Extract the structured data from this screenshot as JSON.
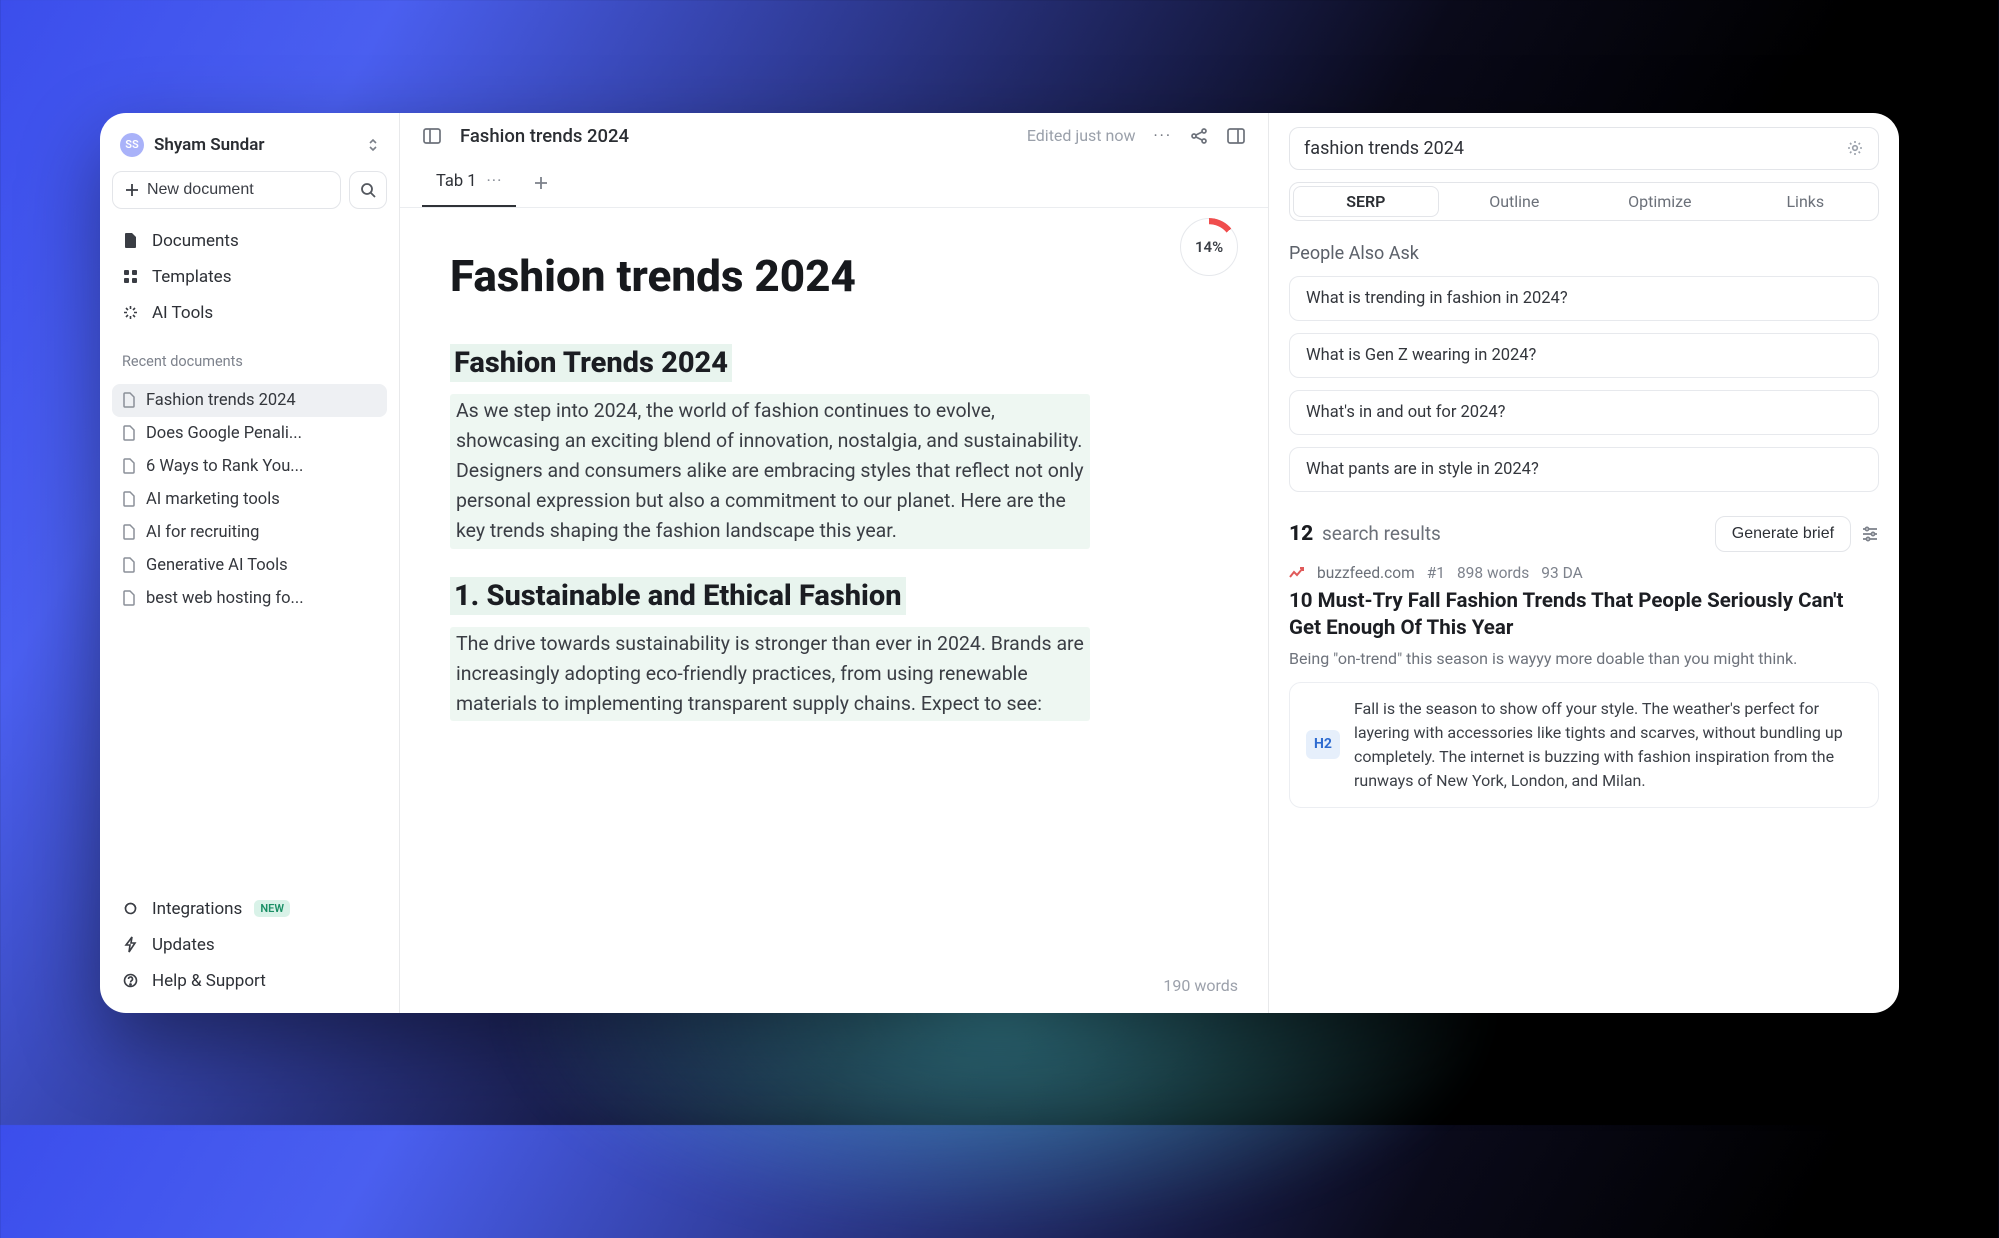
{
  "sidebar": {
    "account_initials": "SS",
    "account_name": "Shyam Sundar",
    "new_document_label": "New document",
    "nav": [
      {
        "label": "Documents"
      },
      {
        "label": "Templates"
      },
      {
        "label": "AI Tools"
      }
    ],
    "recent_header": "Recent documents",
    "recent": [
      {
        "label": "Fashion trends 2024",
        "active": true
      },
      {
        "label": "Does Google Penali..."
      },
      {
        "label": "6 Ways to Rank You..."
      },
      {
        "label": "AI marketing tools"
      },
      {
        "label": "AI for recruiting"
      },
      {
        "label": "Generative AI Tools"
      },
      {
        "label": "best web hosting fo..."
      }
    ],
    "integrations_label": "Integrations",
    "integrations_badge": "NEW",
    "updates_label": "Updates",
    "help_label": "Help & Support"
  },
  "editor": {
    "doc_title": "Fashion trends 2024",
    "edited_label": "Edited just now",
    "tab_label": "Tab 1",
    "score_label": "14%",
    "h1": "Fashion trends 2024",
    "h2a": "Fashion Trends 2024",
    "p1": "As we step into 2024, the world of fashion continues to evolve, showcasing an exciting blend of innovation, nostalgia, and sustainability. Designers and consumers alike are embracing styles that reflect not only personal expression but also a commitment to our planet. Here are the key trends shaping the fashion landscape this year.",
    "h2b": "1. Sustainable and Ethical Fashion",
    "p2": "The drive towards sustainability is stronger than ever in 2024. Brands are increasingly adopting eco-friendly practices, from using renewable materials to implementing transparent supply chains. Expect to see:",
    "word_count": "190 words"
  },
  "rpanel": {
    "query": "fashion trends 2024",
    "tabs": [
      "SERP",
      "Outline",
      "Optimize",
      "Links"
    ],
    "paa_header": "People Also Ask",
    "paa": [
      "What is trending in fashion in 2024?",
      "What is Gen Z wearing in 2024?",
      "What's in and out for 2024?",
      "What pants are in style in 2024?"
    ],
    "results_count": "12",
    "results_label": "search results",
    "generate_brief": "Generate brief",
    "serp1": {
      "domain": "buzzfeed.com",
      "rank": "#1",
      "words": "898 words",
      "da": "93 DA",
      "title": "10 Must-Try Fall Fashion Trends That People Seriously Can't Get Enough Of This Year",
      "desc": "Being \"on-trend\" this season is wayyy more doable than you might think.",
      "snippet_tag": "H2",
      "snippet": "Fall is the season to show off your style. The weather's perfect for layering with accessories like tights and scarves, without bundling up completely. The internet is buzzing with fashion inspiration from the runways of New York, London, and Milan."
    }
  }
}
